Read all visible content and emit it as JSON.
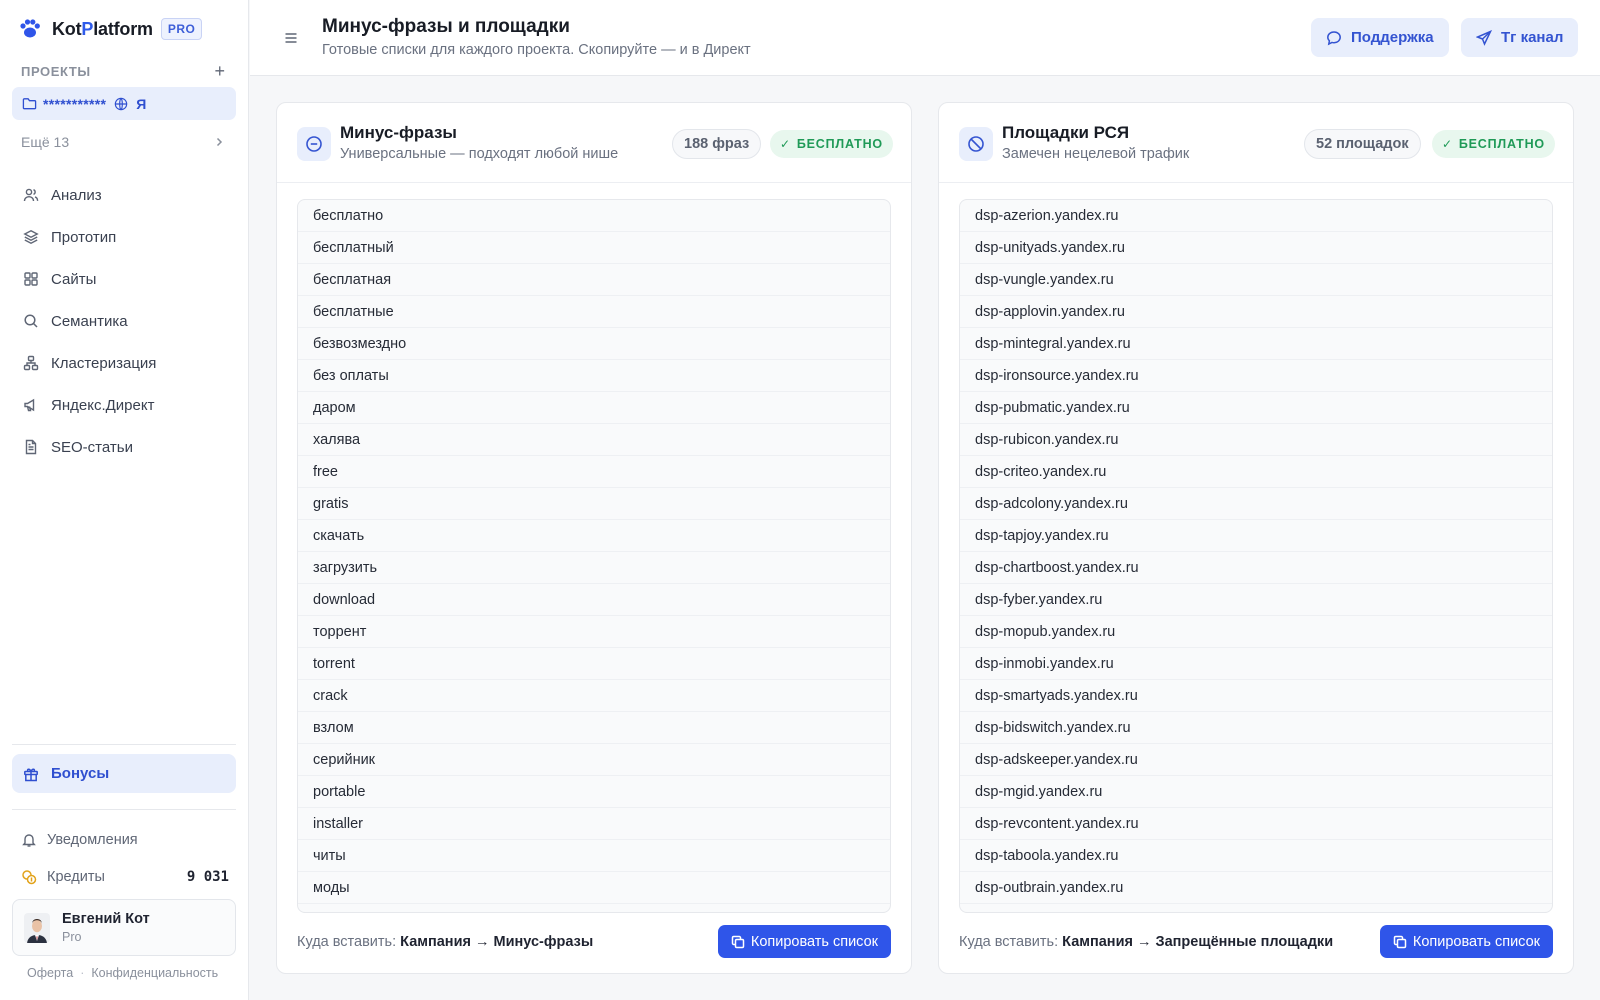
{
  "brand": {
    "name_a": "Kot",
    "name_p": "P",
    "name_b": "latform",
    "badge": "PRO",
    "accent": "#2f55e9"
  },
  "sidebar": {
    "projects_label": "ПРОЕКТЫ",
    "add_icon": "plus-icon",
    "project": {
      "name": "***********",
      "tag": "Я"
    },
    "more_label": "Ещё 13",
    "items": [
      {
        "label": "Анализ",
        "icon": "users-icon"
      },
      {
        "label": "Прототип",
        "icon": "layers-icon"
      },
      {
        "label": "Сайты",
        "icon": "grid-icon"
      },
      {
        "label": "Семантика",
        "icon": "search-icon"
      },
      {
        "label": "Кластеризация",
        "icon": "cluster-icon"
      },
      {
        "label": "Яндекс.Директ",
        "icon": "megaphone-icon"
      },
      {
        "label": "SEO-статьи",
        "icon": "document-icon"
      }
    ],
    "bonus_label": "Бонусы",
    "notifications_label": "Уведомления",
    "credits_label": "Кредиты",
    "credits_value": "9 031",
    "user": {
      "name": "Евгений Кот",
      "plan": "Pro"
    },
    "footer": {
      "offer": "Оферта",
      "privacy": "Конфиденциальность"
    }
  },
  "header": {
    "title": "Минус-фразы и площадки",
    "subtitle": "Готовые списки для каждого проекта. Скопируйте — и в Директ",
    "support_label": "Поддержка",
    "tg_label": "Тг канал"
  },
  "cards": {
    "phrases": {
      "title": "Минус-фразы",
      "subtitle": "Универсальные — подходят любой нише",
      "count": "188 фраз",
      "free": "БЕСПЛАТНО",
      "rows": [
        "бесплатно",
        "бесплатный",
        "бесплатная",
        "бесплатные",
        "безвозмездно",
        "без оплаты",
        "даром",
        "халява",
        "free",
        "gratis",
        "скачать",
        "загрузить",
        "download",
        "торрент",
        "torrent",
        "crack",
        "взлом",
        "серийник",
        "portable",
        "installer",
        "читы",
        "моды"
      ],
      "where_label": "Куда вставить:",
      "where_value": "Кампания → Минус-фразы",
      "copy_label": "Копировать список"
    },
    "placements": {
      "title": "Площадки РСЯ",
      "subtitle": "Замечен нецелевой трафик",
      "count": "52 площадок",
      "free": "БЕСПЛАТНО",
      "rows": [
        "dsp-azerion.yandex.ru",
        "dsp-unityads.yandex.ru",
        "dsp-vungle.yandex.ru",
        "dsp-applovin.yandex.ru",
        "dsp-mintegral.yandex.ru",
        "dsp-ironsource.yandex.ru",
        "dsp-pubmatic.yandex.ru",
        "dsp-rubicon.yandex.ru",
        "dsp-criteo.yandex.ru",
        "dsp-adcolony.yandex.ru",
        "dsp-tapjoy.yandex.ru",
        "dsp-chartboost.yandex.ru",
        "dsp-fyber.yandex.ru",
        "dsp-mopub.yandex.ru",
        "dsp-inmobi.yandex.ru",
        "dsp-smartyads.yandex.ru",
        "dsp-bidswitch.yandex.ru",
        "dsp-adskeeper.yandex.ru",
        "dsp-mgid.yandex.ru",
        "dsp-revcontent.yandex.ru",
        "dsp-taboola.yandex.ru",
        "dsp-outbrain.yandex.ru"
      ],
      "where_label": "Куда вставить:",
      "where_value": "Кампания → Запрещённые площадки",
      "copy_label": "Копировать список"
    }
  }
}
